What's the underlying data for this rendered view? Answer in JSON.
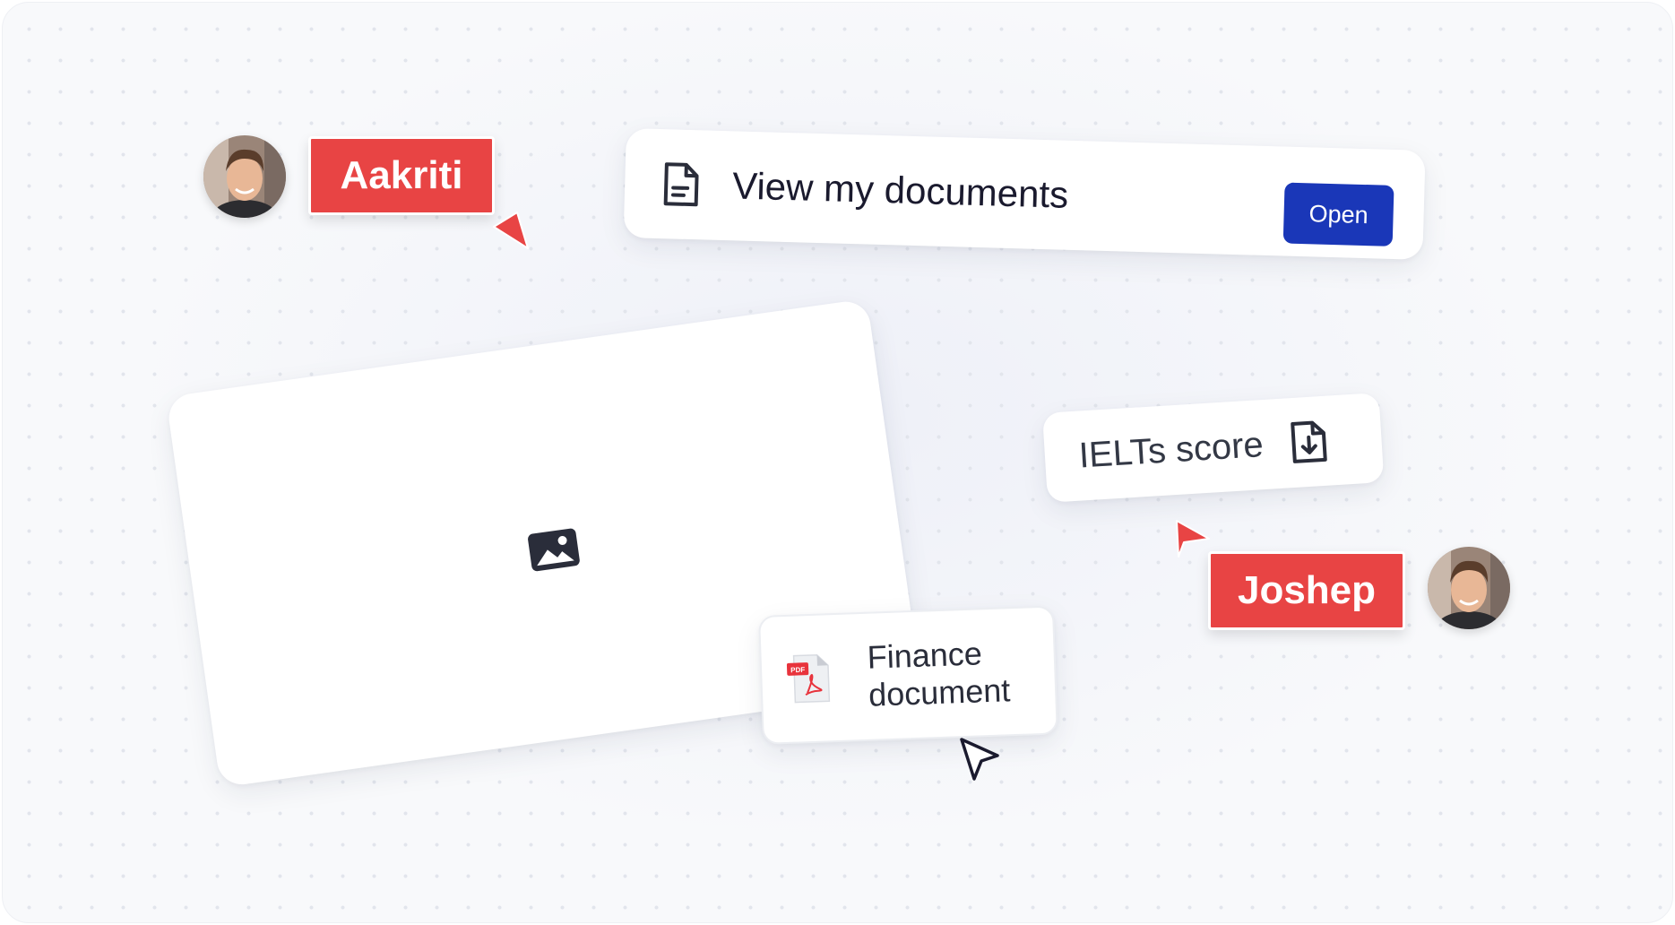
{
  "users": [
    {
      "name": "Aakriti"
    },
    {
      "name": "Joshep"
    }
  ],
  "documents_card": {
    "label": "View my documents",
    "button_label": "Open",
    "icon": "document-icon"
  },
  "ielts_card": {
    "label": "IELTs score",
    "icon": "document-download-icon"
  },
  "finance_card": {
    "line1": "Finance",
    "line2": "document",
    "icon": "pdf-file-icon",
    "badge": "PDF"
  },
  "image_card": {
    "icon": "image-placeholder-icon"
  },
  "colors": {
    "tag_red": "#e84444",
    "button_blue": "#1a37b8",
    "background": "#f8f9fb"
  }
}
